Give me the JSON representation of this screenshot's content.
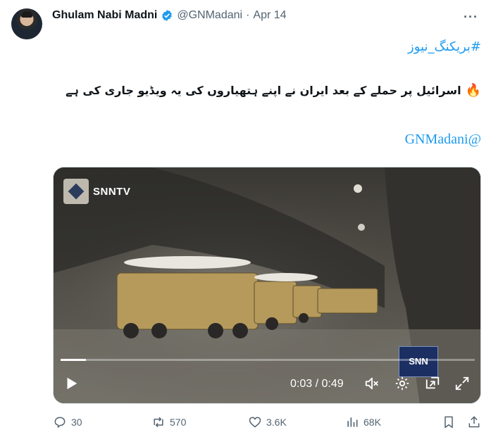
{
  "author": {
    "name": "Ghulam Nabi Madni",
    "handle": "@GNMadani",
    "separator": "·",
    "date": "Apr 14",
    "avatar_icon": "user-avatar",
    "verified_icon": "verified-badge-icon",
    "verified_color": "#1d9bf0"
  },
  "tweet": {
    "hashtag": "#بریکنگ_نیوز",
    "emoji": "🔥",
    "text": "اسرائیل پر حملے کے بعد ایران نے اپنے ہتھیاروں کی یہ ویڈیو جاری کی ہے",
    "mention": "GNMadani@"
  },
  "video": {
    "watermark": "SNNTV",
    "corner_logo": "SNN",
    "current_time": "0:03",
    "duration": "0:49",
    "time_display": "0:03 / 0:49",
    "progress": 0.061,
    "icons": [
      "play-icon",
      "volume-icon",
      "settings-icon",
      "pip-icon",
      "fullscreen-icon"
    ]
  },
  "actions": {
    "replies": "30",
    "reposts": "570",
    "likes": "3.6K",
    "views": "68K"
  },
  "colors": {
    "accent": "#1d9bf0",
    "muted": "#536471"
  }
}
